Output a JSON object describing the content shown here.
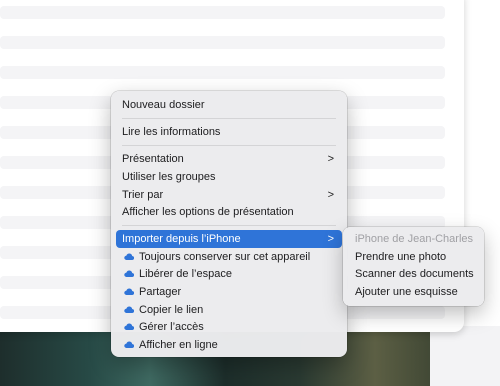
{
  "menu": {
    "new_folder": "Nouveau dossier",
    "get_info": "Lire les informations",
    "presentation": "Présentation",
    "use_groups": "Utiliser les groupes",
    "sort_by": "Trier par",
    "show_view_options": "Afficher les options de présentation",
    "import_from_iphone": "Importer depuis l’iPhone",
    "keep_on_device": "Toujours conserver sur cet appareil",
    "free_space": "Libérer de l’espace",
    "share": "Partager",
    "copy_link": "Copier le lien",
    "manage_access": "Gérer l’accès",
    "show_online": "Afficher en ligne",
    "chevron": ">"
  },
  "submenu": {
    "device_name": "iPhone de Jean-Charles",
    "take_photo": "Prendre une photo",
    "scan_documents": "Scanner des documents",
    "add_sketch": "Ajouter une esquisse"
  },
  "colors": {
    "highlight": "#2f74d8",
    "cloud_icon": "#2f74d8",
    "menu_background": "#ececee"
  },
  "icons": {
    "submenu_indicator": "chevron-right-icon",
    "icloud": "cloud-icon"
  }
}
